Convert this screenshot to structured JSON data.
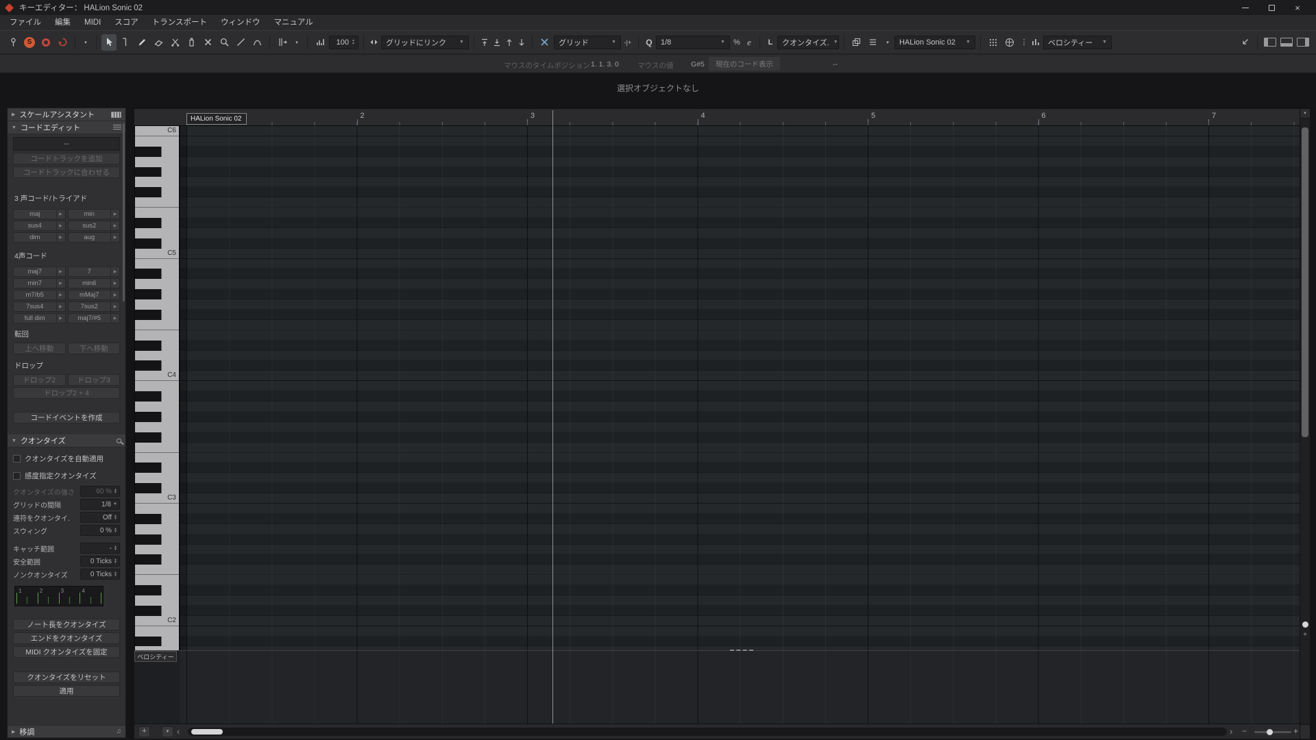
{
  "window": {
    "title": "キーエディター：  HALion Sonic 02"
  },
  "menubar": [
    "ファイル",
    "編集",
    "MIDI",
    "スコア",
    "トランスポート",
    "ウィンドウ",
    "マニュアル"
  ],
  "toolbar": {
    "solo_label": "S",
    "insert_velocity": "100",
    "grid_link": "グリッドにリンク",
    "grid_type": "グリッド",
    "mp_icon": "-|+",
    "q_letter": "Q",
    "quantize_preset": "1/8",
    "percent_icon": "%",
    "e_letter": "e",
    "length_quantize_prefix": "L",
    "length_quantize": "クオンタイズ.",
    "part_selector": "HALion Sonic 02",
    "event_colors": "ベロシティー"
  },
  "infoline": {
    "mouse_time_label": "マウスのタイムポジション",
    "mouse_time_value": "1. 1. 3. 0",
    "mouse_value_label": "マウスの値",
    "mouse_value_value": "G#5",
    "chord_display_label": "現在のコード表示",
    "chord_display_value": "--"
  },
  "status": "選択オブジェクトなし",
  "panel": {
    "scale_assistant": "スケールアシスタント",
    "chord_edit": {
      "title": "コードエディット",
      "current_chord": "--",
      "add_chord_track": "コードトラックを追加",
      "match_chord_track": "コードトラックに合わせる",
      "triads_label": "3 声コード/トライアド",
      "triads": [
        [
          "maj",
          "min"
        ],
        [
          "sus4",
          "sus2"
        ],
        [
          "dim",
          "aug"
        ]
      ],
      "tetrads_label": "4声コード",
      "tetrads": [
        [
          "maj7",
          "7"
        ],
        [
          "min7",
          "min6"
        ],
        [
          "m7/b5",
          "mMaj7"
        ],
        [
          "7sus4",
          "7sus2"
        ],
        [
          "full dim",
          "maj7/#5"
        ]
      ],
      "inversions_label": "転回",
      "inversion_buttons": [
        "上へ移動",
        "下へ移動"
      ],
      "drop_label": "ドロップ",
      "drop_buttons": [
        "ドロップ2",
        "ドロップ3"
      ],
      "drop_wide_button": "ドロップ2 + 4",
      "create_event_button": "コードイベントを作成"
    },
    "quantize": {
      "title": "クオンタイズ",
      "checkboxes": [
        "クオンタイズを自動適用",
        "感度指定クオンタイズ"
      ],
      "rows": [
        {
          "label": "クオンタイズの強さ",
          "value": "60 %",
          "type": "stepper",
          "disabled": true
        },
        {
          "label": "グリッドの間隔",
          "value": "1/8",
          "type": "dropdown"
        },
        {
          "label": "連符をクオンタイ.",
          "value": "Off",
          "type": "stepper"
        },
        {
          "label": "スウィング",
          "value": "0 %",
          "type": "stepper"
        },
        {
          "label": "キャッチ範囲",
          "value": "-",
          "type": "stepper",
          "gap": true
        },
        {
          "label": "安全範囲",
          "value": "0 Ticks",
          "type": "stepper"
        },
        {
          "label": "ノンクオンタイズ",
          "value": "0 Ticks",
          "type": "stepper"
        }
      ],
      "grid_numbers": [
        "1",
        "2",
        "3",
        "4"
      ],
      "action_buttons": [
        "ノート長をクオンタイズ",
        "エンドをクオンタイズ",
        "MIDI クオンタイズを固定"
      ],
      "bottom_buttons": [
        "クオンタイズをリセット",
        "適用"
      ]
    },
    "transpose": "移調"
  },
  "editor": {
    "part_label": "HALion Sonic 02",
    "ruler_bars": [
      "2",
      "3",
      "4",
      "5",
      "6",
      "7"
    ],
    "octaves": [
      "C6",
      "C5",
      "C4",
      "C3",
      "C2"
    ],
    "velocity_label": "ベロシティー"
  },
  "icons": {
    "plus": "+",
    "minus": "−",
    "down_arrow": "▼",
    "small_down": "▾",
    "left_chevron": "‹",
    "right_chevron": "›",
    "play_arrow": "▶",
    "up_tri": "▲",
    "down_tri": "▼"
  }
}
